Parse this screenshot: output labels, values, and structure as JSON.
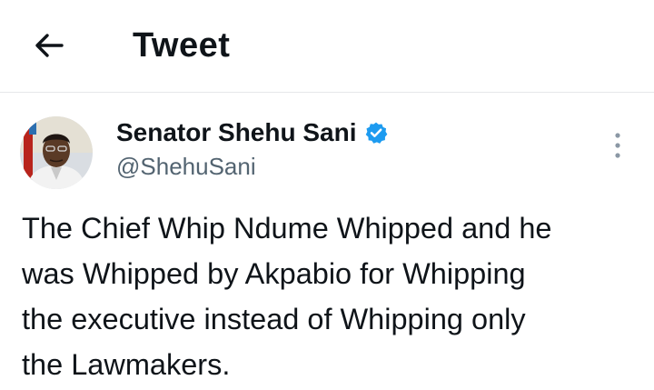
{
  "header": {
    "back_icon": "arrow-left-icon",
    "title": "Tweet"
  },
  "tweet": {
    "author_name": "Senator Shehu Sani",
    "verified_icon": "verified-badge-icon",
    "verified_color": "#1d9bf0",
    "handle": "@ShehuSani",
    "more_icon": "more-vertical-icon",
    "text": "The Chief Whip Ndume Whipped and he\nwas Whipped by Akpabio for Whipping\nthe executive instead of Whipping only\nthe Lawmakers."
  }
}
